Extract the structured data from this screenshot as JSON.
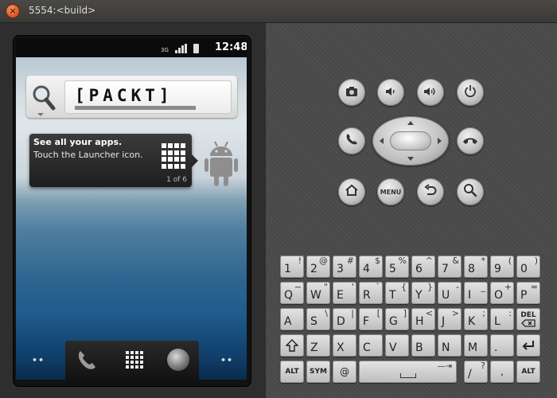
{
  "window": {
    "title": "5554:<build>"
  },
  "statusbar": {
    "network": "3G",
    "time": "12:48"
  },
  "search_widget": {
    "text": "[PACKT]"
  },
  "tip": {
    "title": "See all your apps.",
    "body": "Touch the Launcher icon.",
    "counter": "1 of 6"
  },
  "home_dots": {
    "left": "••",
    "right": "••"
  },
  "controls": {
    "menu_label": "MENU"
  },
  "keyboard": {
    "row1": [
      {
        "main": "1",
        "alt": "!"
      },
      {
        "main": "2",
        "alt": "@"
      },
      {
        "main": "3",
        "alt": "#"
      },
      {
        "main": "4",
        "alt": "$"
      },
      {
        "main": "5",
        "alt": "%"
      },
      {
        "main": "6",
        "alt": "^"
      },
      {
        "main": "7",
        "alt": "&"
      },
      {
        "main": "8",
        "alt": "*"
      },
      {
        "main": "9",
        "alt": "("
      },
      {
        "main": "0",
        "alt": ")"
      }
    ],
    "row2": [
      {
        "main": "Q",
        "alt": "~"
      },
      {
        "main": "W",
        "alt": "\""
      },
      {
        "main": "E",
        "alt": "'"
      },
      {
        "main": "R",
        "alt": "`"
      },
      {
        "main": "T",
        "alt": "{"
      },
      {
        "main": "Y",
        "alt": "}"
      },
      {
        "main": "U",
        "alt": "-"
      },
      {
        "main": "I",
        "alt": "_"
      },
      {
        "main": "O",
        "alt": "+"
      },
      {
        "main": "P",
        "alt": "="
      }
    ],
    "row3": [
      {
        "main": "A",
        "alt": ""
      },
      {
        "main": "S",
        "alt": "\\"
      },
      {
        "main": "D",
        "alt": "|"
      },
      {
        "main": "F",
        "alt": "["
      },
      {
        "main": "G",
        "alt": "]"
      },
      {
        "main": "H",
        "alt": "<"
      },
      {
        "main": "J",
        "alt": ">"
      },
      {
        "main": "K",
        "alt": ";"
      },
      {
        "main": "L",
        "alt": ":"
      }
    ],
    "del_label": "DEL",
    "row4": [
      {
        "main": "Z",
        "alt": ""
      },
      {
        "main": "X",
        "alt": ""
      },
      {
        "main": "C",
        "alt": ""
      },
      {
        "main": "V",
        "alt": ""
      },
      {
        "main": "B",
        "alt": ""
      },
      {
        "main": "N",
        "alt": ""
      },
      {
        "main": "M",
        "alt": ""
      },
      {
        "main": ".",
        "alt": ""
      }
    ],
    "alt_label": "ALT",
    "sym_label": "SYM",
    "at_label": "@",
    "slash_main": "/",
    "slash_alt": "?",
    "comma_label": ","
  }
}
